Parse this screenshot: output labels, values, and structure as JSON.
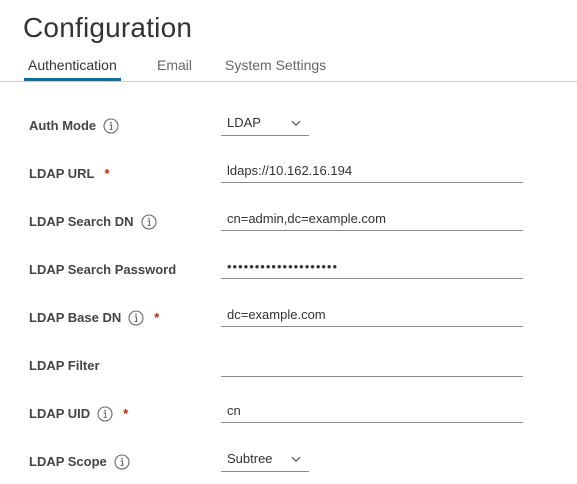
{
  "page": {
    "title": "Configuration"
  },
  "tabs": [
    {
      "label": "Authentication",
      "active": true
    },
    {
      "label": "Email",
      "active": false
    },
    {
      "label": "System Settings",
      "active": false
    }
  ],
  "form": {
    "auth_mode": {
      "label": "Auth Mode",
      "value": "LDAP"
    },
    "ldap_url": {
      "label": "LDAP URL",
      "required": "*",
      "value": "ldaps://10.162.16.194"
    },
    "ldap_search_dn": {
      "label": "LDAP Search DN",
      "value": "cn=admin,dc=example.com"
    },
    "ldap_search_password": {
      "label": "LDAP Search Password",
      "value": "••••••••••••••••••••"
    },
    "ldap_base_dn": {
      "label": "LDAP Base DN",
      "required": "*",
      "value": "dc=example.com"
    },
    "ldap_filter": {
      "label": "LDAP Filter",
      "value": ""
    },
    "ldap_uid": {
      "label": "LDAP UID",
      "required": "*",
      "value": "cn"
    },
    "ldap_scope": {
      "label": "LDAP Scope",
      "value": "Subtree"
    }
  },
  "colors": {
    "accent": "#0072a3",
    "required": "#c92100",
    "text": "#333333",
    "muted": "#666666"
  },
  "icons": {
    "info": "info-circle-icon",
    "dropdown": "chevron-down-icon"
  }
}
